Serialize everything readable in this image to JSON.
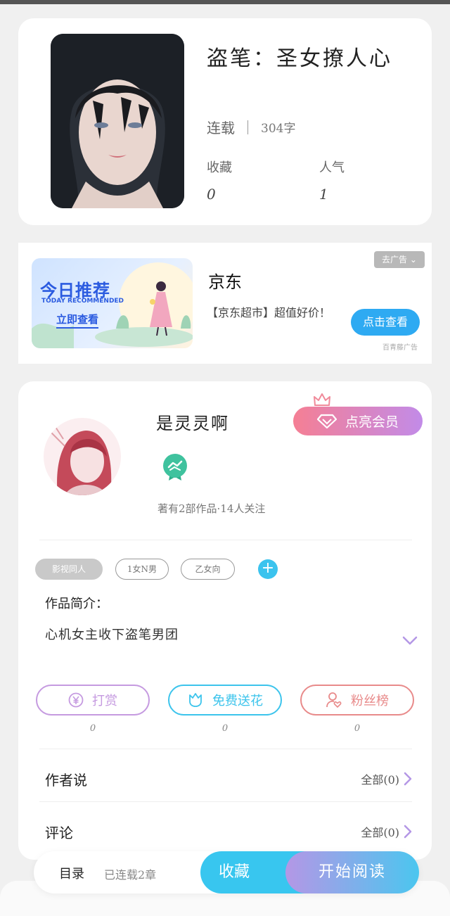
{
  "book": {
    "title": "盗笔：圣女撩人心",
    "status": "连载",
    "word_count": "304字",
    "favorites_label": "收藏",
    "favorites_value": "0",
    "popularity_label": "人气",
    "popularity_value": "1"
  },
  "ad": {
    "banner_title": "今日推荐",
    "banner_subtitle": "TODAY RECOMMENDED",
    "banner_cta": "立即查看",
    "title": "京东",
    "description": "【京东超市】超值好价！",
    "close_label": "去广告",
    "button_label": "点击查看",
    "source": "百青藤广告"
  },
  "author": {
    "name": "是灵灵啊",
    "vip_label": "点亮会员",
    "meta": "著有2部作品·14人关注",
    "tags": [
      "影视同人",
      "1女N男",
      "乙女向"
    ],
    "intro_label": "作品简介：",
    "intro_text": "心机女主收下盗笔男团"
  },
  "actions": [
    {
      "label": "打赏",
      "count": "0",
      "color": "#c59ae0"
    },
    {
      "label": "免费送花",
      "count": "0",
      "color": "#3cc4ec"
    },
    {
      "label": "粉丝榜",
      "count": "0",
      "color": "#e88a8a"
    }
  ],
  "rows": {
    "author_says": "作者说",
    "author_says_right": "全部(0)",
    "comments": "评论",
    "comments_right": "全部(0)"
  },
  "bottom": {
    "toc": "目录",
    "chapters": "已连载2章",
    "favorite": "收藏",
    "start_reading": "开始阅读"
  },
  "colors": {
    "accent_blue": "#38c6ef",
    "accent_purple": "#b497e6",
    "vip_pink": "#f57f94"
  }
}
